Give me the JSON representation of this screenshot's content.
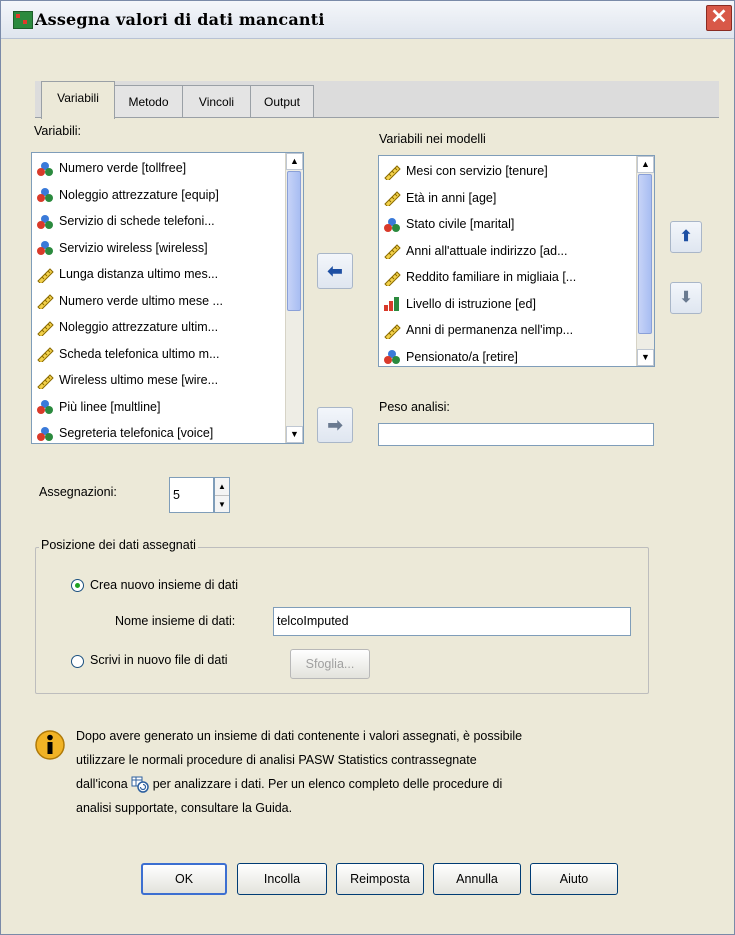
{
  "window": {
    "title": "Assegna valori di dati mancanti",
    "close_label": "✕"
  },
  "tabs": [
    {
      "label": "Variabili",
      "active": true
    },
    {
      "label": "Metodo",
      "active": false
    },
    {
      "label": "Vincoli",
      "active": false
    },
    {
      "label": "Output",
      "active": false
    }
  ],
  "variables_panel": {
    "label": "Variabili:",
    "items": [
      {
        "label": "Numero verde [tollfree]",
        "icon": "nominal-icon"
      },
      {
        "label": "Noleggio attrezzature [equip]",
        "icon": "nominal-icon"
      },
      {
        "label": "Servizio di schede telefoni...",
        "icon": "nominal-icon"
      },
      {
        "label": "Servizio wireless [wireless]",
        "icon": "nominal-icon"
      },
      {
        "label": "Lunga distanza ultimo mes...",
        "icon": "scale-icon"
      },
      {
        "label": "Numero verde ultimo mese ...",
        "icon": "scale-icon"
      },
      {
        "label": "Noleggio attrezzature ultim...",
        "icon": "scale-icon"
      },
      {
        "label": "Scheda telefonica ultimo m...",
        "icon": "scale-icon"
      },
      {
        "label": "Wireless ultimo mese [wire...",
        "icon": "scale-icon"
      },
      {
        "label": "Più linee [multline]",
        "icon": "nominal-icon"
      },
      {
        "label": "Segreteria telefonica [voice]",
        "icon": "nominal-icon"
      }
    ]
  },
  "model_panel": {
    "label": "Variabili nei modelli",
    "items": [
      {
        "label": "Mesi con servizio [tenure]",
        "icon": "scale-icon"
      },
      {
        "label": "Età in anni [age]",
        "icon": "scale-icon"
      },
      {
        "label": "Stato civile [marital]",
        "icon": "nominal-icon"
      },
      {
        "label": "Anni all'attuale indirizzo [ad...",
        "icon": "scale-icon"
      },
      {
        "label": "Reddito familiare in migliaia [...",
        "icon": "scale-icon"
      },
      {
        "label": "Livello di istruzione [ed]",
        "icon": "ordinal-icon"
      },
      {
        "label": "Anni di permanenza nell'imp...",
        "icon": "scale-icon"
      },
      {
        "label": "Pensionato/a [retire]",
        "icon": "nominal-icon"
      }
    ]
  },
  "weight": {
    "label": "Peso analisi:",
    "value": ""
  },
  "imputations": {
    "label": "Assegnazioni:",
    "value": "5"
  },
  "dataset_group": {
    "title": "Posizione dei dati assegnati",
    "option_new_dataset": "Crea nuovo insieme di dati",
    "dataset_name_label": "Nome insieme di dati:",
    "dataset_name_value": "telcoImputed",
    "option_new_file": "Scrivi in nuovo file di dati",
    "browse_label": "Sfoglia..."
  },
  "info": {
    "line1": "Dopo avere generato un insieme di dati contenente i valori assegnati, è possibile",
    "line2": "utilizzare le normali procedure di analisi PASW Statistics contrassegnate",
    "line3_pre": "dall'icona",
    "line3_post": "per analizzare i dati. Per un elenco completo delle procedure di",
    "line4": "analisi supportate, consultare la Guida."
  },
  "buttons": {
    "ok": "OK",
    "paste": "Incolla",
    "reset": "Reimposta",
    "cancel": "Annulla",
    "help": "Aiuto"
  },
  "colors": {
    "title_bar": "#e8edf4",
    "close": "#d85848",
    "accent": "#1e4fa3",
    "radio_dot": "#21a121"
  }
}
